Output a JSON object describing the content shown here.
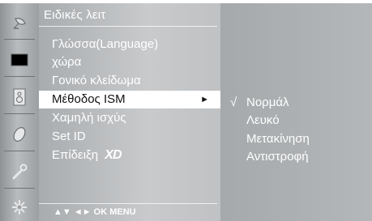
{
  "menu": {
    "title": "Ειδικές λειτ",
    "items": [
      {
        "label": "Γλώσσα(Language)"
      },
      {
        "label": "χώρα"
      },
      {
        "label": "Γονικό κλείδωμα"
      },
      {
        "label": "Μέθοδος ISM",
        "selected": true,
        "arrow": "►"
      },
      {
        "label": "Χαμηλή ισχύς"
      },
      {
        "label": "Set ID"
      },
      {
        "label": "Επίδειξη",
        "suffix_logo": "XD"
      }
    ],
    "nav_hint": "▲▼  ◄►  OK  MENU"
  },
  "submenu": {
    "check_mark": "√",
    "items": [
      {
        "label": "Νορμάλ",
        "checked": true
      },
      {
        "label": "Λευκό"
      },
      {
        "label": "Μετακίνηση"
      },
      {
        "label": "Αντιστροφή"
      }
    ]
  },
  "sidebar": {
    "icons": [
      "satellite-dish-icon",
      "screen-icon",
      "speaker-icon",
      "clock-icon",
      "wrench-icon",
      "settings-gear-icon"
    ]
  },
  "colors": {
    "panel": "#b9bcbe",
    "text": "#ffffff",
    "highlight": "#ffffff"
  }
}
